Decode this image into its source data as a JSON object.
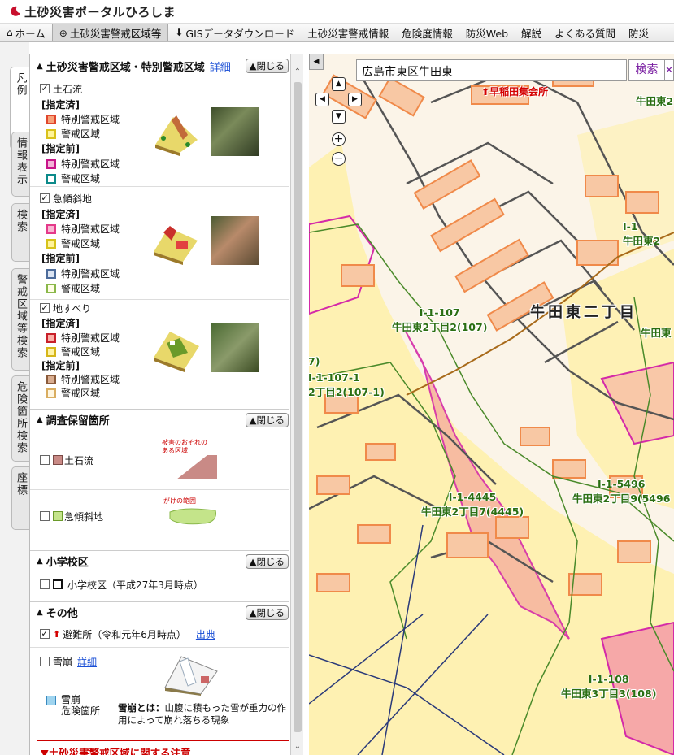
{
  "app": {
    "title": "土砂災害ポータルひろしま"
  },
  "nav": [
    {
      "label": "ホーム",
      "icon": "home-icon"
    },
    {
      "label": "土砂災害警戒区域等",
      "icon": "globe-icon"
    },
    {
      "label": "GISデータダウンロード",
      "icon": "download-icon"
    },
    {
      "label": "土砂災害警戒情報"
    },
    {
      "label": "危険度情報"
    },
    {
      "label": "防災Web"
    },
    {
      "label": "解説"
    },
    {
      "label": "よくある質問"
    },
    {
      "label": "防災"
    }
  ],
  "side_tabs": [
    "凡例",
    "情報表示",
    "検索",
    "警戒区域等検索",
    "危険箇所検索",
    "座標"
  ],
  "legend": {
    "section1": {
      "title": "土砂災害警戒区域・特別警戒区域",
      "detail_label": "詳細",
      "close_label": "▲閉じる",
      "groups": [
        {
          "name": "土石流",
          "checked": true,
          "designated_label": "[指定済]",
          "predesignated_label": "[指定前]",
          "items": [
            {
              "label": "特別警戒区域",
              "border": "#e0462c",
              "fill": "#f7a27a"
            },
            {
              "label": "警戒区域",
              "border": "#d9c21c",
              "fill": "#fff49a"
            },
            {
              "label": "特別警戒区域",
              "border": "#c8148a",
              "fill": "#f3b4d8"
            },
            {
              "label": "警戒区域",
              "border": "#0c8a8a",
              "fill": "#ffffff"
            }
          ]
        },
        {
          "name": "急傾斜地",
          "checked": true,
          "designated_label": "[指定済]",
          "predesignated_label": "[指定前]",
          "items": [
            {
              "label": "特別警戒区域",
              "border": "#e43a8a",
              "fill": "#f9b7d3"
            },
            {
              "label": "警戒区域",
              "border": "#d6c31a",
              "fill": "#fff39a"
            },
            {
              "label": "特別警戒区域",
              "border": "#4c6b9a",
              "fill": "#dbe4f2"
            },
            {
              "label": "警戒区域",
              "border": "#8ab84a",
              "fill": "#fffde6"
            }
          ]
        },
        {
          "name": "地すべり",
          "checked": true,
          "designated_label": "[指定済]",
          "predesignated_label": "[指定前]",
          "items": [
            {
              "label": "特別警戒区域",
              "border": "#c8202a",
              "fill": "#fbb0a8"
            },
            {
              "label": "警戒区域",
              "border": "#d6b61a",
              "fill": "#fff3a6"
            },
            {
              "label": "特別警戒区域",
              "border": "#8a5a3a",
              "fill": "#d9ad90"
            },
            {
              "label": "警戒区域",
              "border": "#d9ad60",
              "fill": "#fff6e0"
            }
          ]
        }
      ]
    },
    "section2": {
      "title": "調査保留箇所",
      "close_label": "▲閉じる",
      "items": [
        {
          "label": "土石流",
          "checked": false,
          "fill": "#c98a86",
          "caption": "被害のおそれのある区域"
        },
        {
          "label": "急傾斜地",
          "checked": false,
          "fill": "#c4e48a",
          "caption": "がけの範囲"
        }
      ]
    },
    "section3": {
      "title": "小学校区",
      "close_label": "▲閉じる",
      "item": "小学校区（平成27年3月時点）"
    },
    "section4": {
      "title": "その他",
      "close_label": "▲閉じる",
      "shelter": {
        "label": "避難所（令和元年6月時点）",
        "source_label": "出典",
        "checked": true
      },
      "avalanche": {
        "label": "雪崩",
        "detail_label": "詳細",
        "checked": false
      },
      "avalanche_area": {
        "line1": "雪崩",
        "line2": "危険箇所",
        "fill": "#9fd4ef"
      },
      "avalanche_desc_bold": "雪崩とは：",
      "avalanche_desc": "山腹に積もった雪が重力の作用によって崩れ落ちる現象"
    },
    "caution_title": "▼土砂災害警戒区域に関する注意"
  },
  "map": {
    "search_value": "広島市東区牛田東",
    "search_button": "検索",
    "clear_button": "✕",
    "place_name": "牛田東二丁目",
    "shelter_name": "早稲田集会所",
    "zone_labels": [
      {
        "code": "I-1-107",
        "name": "牛田東2丁目2(107)"
      },
      {
        "code": "I-1-107-1",
        "name": "2丁目2(107-1)"
      },
      {
        "code": "I-1-4445",
        "name": "牛田東2丁目7(4445)"
      },
      {
        "code": "I-1-5496",
        "name": "牛田東2丁目9(5496"
      },
      {
        "code": "I-1-108",
        "name": "牛田東3丁目3(108)"
      },
      {
        "code": "I-1",
        "name": "牛田東2"
      },
      {
        "code": "7)",
        "name": ""
      },
      {
        "code": "",
        "name": "牛田東2"
      },
      {
        "code": "",
        "name": "牛田東"
      }
    ]
  }
}
